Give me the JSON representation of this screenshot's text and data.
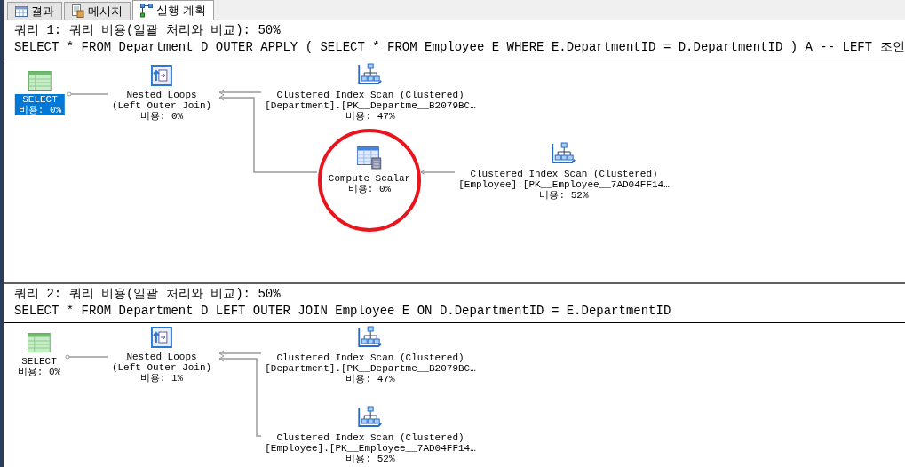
{
  "tabs": [
    {
      "label": "결과",
      "kind": "grid",
      "selected": false
    },
    {
      "label": "메시지",
      "kind": "messages",
      "selected": false
    },
    {
      "label": "실행 계획",
      "kind": "plan",
      "selected": true
    }
  ],
  "queries": [
    {
      "header": "쿼리 1: 쿼리 비용(일괄 처리와 비교): 50%",
      "sql": "SELECT * FROM Department D OUTER APPLY ( SELECT * FROM Employee E WHERE E.DepartmentID = D.DepartmentID ) A -- LEFT 조인",
      "plan": {
        "kind": "select",
        "lines": [
          "SELECT"
        ],
        "cost": "비용: 0%",
        "selected": true,
        "circled": false,
        "children": [
          {
            "kind": "nested_loops",
            "lines": [
              "Nested Loops",
              "(Left Outer Join)"
            ],
            "cost": "비용: 0%",
            "selected": false,
            "circled": false,
            "children": [
              {
                "kind": "index_scan",
                "lines": [
                  "Clustered Index Scan (Clustered)",
                  "[Department].[PK__Departme__B2079BC…"
                ],
                "cost": "비용: 47%",
                "selected": false,
                "circled": false
              },
              {
                "kind": "compute_scalar",
                "lines": [
                  "Compute Scalar"
                ],
                "cost": "비용: 0%",
                "selected": false,
                "circled": true,
                "children": [
                  {
                    "kind": "index_scan",
                    "lines": [
                      "Clustered Index Scan (Clustered)",
                      "[Employee].[PK__Employee__7AD04FF14…"
                    ],
                    "cost": "비용: 52%",
                    "selected": false,
                    "circled": false
                  }
                ]
              }
            ]
          }
        ]
      }
    },
    {
      "header": "쿼리 2: 쿼리 비용(일괄 처리와 비교): 50%",
      "sql": "SELECT * FROM Department D LEFT OUTER JOIN Employee E ON D.DepartmentID = E.DepartmentID",
      "plan": {
        "kind": "select",
        "lines": [
          "SELECT"
        ],
        "cost": "비용: 0%",
        "selected": false,
        "circled": false,
        "children": [
          {
            "kind": "nested_loops",
            "lines": [
              "Nested Loops",
              "(Left Outer Join)"
            ],
            "cost": "비용: 1%",
            "selected": false,
            "circled": false,
            "children": [
              {
                "kind": "index_scan",
                "lines": [
                  "Clustered Index Scan (Clustered)",
                  "[Department].[PK__Departme__B2079BC…"
                ],
                "cost": "비용: 47%",
                "selected": false,
                "circled": false
              },
              {
                "kind": "index_scan",
                "lines": [
                  "Clustered Index Scan (Clustered)",
                  "[Employee].[PK__Employee__7AD04FF14…"
                ],
                "cost": "비용: 52%",
                "selected": false,
                "circled": false
              }
            ]
          }
        ]
      }
    }
  ]
}
